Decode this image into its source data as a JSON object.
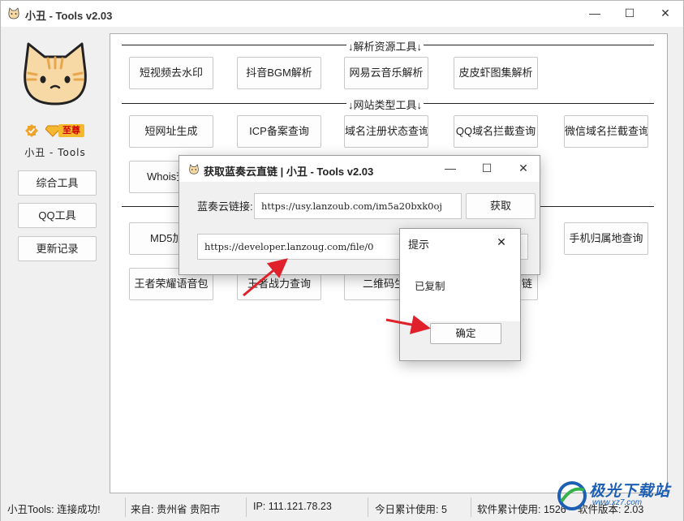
{
  "window": {
    "title": "小丑 - Tools v2.03",
    "controls": {
      "minimize": "—",
      "maximize": "☐",
      "close": "✕"
    }
  },
  "sidebar": {
    "user_name": "小丑 - Tools",
    "vip_badge": "至尊",
    "buttons": [
      "综合工具",
      "QQ工具",
      "更新记录"
    ]
  },
  "main": {
    "sections": [
      {
        "title": "↓解析资源工具↓"
      },
      {
        "title": "↓网站类型工具↓"
      }
    ],
    "row1": [
      "短视频去水印",
      "抖音BGM解析",
      "网易云音乐解析",
      "皮皮虾图集解析"
    ],
    "row2": [
      "短网址生成",
      "ICP备案查询",
      "域名注册状态查询",
      "QQ域名拦截查询",
      "微信域名拦截查询"
    ],
    "row3": [
      "Whois查"
    ],
    "row4": [
      "MD5加",
      "手机归属地查询"
    ],
    "row5": [
      "王者荣耀语音包",
      "王者战力查询",
      "二维码生",
      "链"
    ]
  },
  "dialog": {
    "title": "获取蓝奏云直链 | 小丑 - Tools v2.03",
    "label": "蓝奏云链接:",
    "input_value": "https://usy.lanzoub.com/im5a20bxk0oj",
    "fetch_button": "获取",
    "output_value": "https://developer.lanzoug.com/file/0",
    "controls": {
      "minimize": "—",
      "maximize": "☐",
      "close": "✕"
    }
  },
  "message_box": {
    "title": "提示",
    "message": "已复制",
    "ok_button": "确定",
    "close": "✕"
  },
  "statusbar": {
    "connection": "小丑Tools: 连接成功!",
    "location": "来自: 贵州省 贵阳市",
    "ip": "IP: 111.121.78.23",
    "today_usage": "今日累计使用: 5",
    "total_usage": "软件累计使用: 1526",
    "version": "软件版本: 2.03"
  },
  "watermark": {
    "text": "极光下载站",
    "sub": "www.xz7.com"
  },
  "colors": {
    "accent_red": "#e0202a",
    "watermark_blue": "#1d5fb4",
    "cat_face": "#f7d9a6",
    "cat_stripe": "#e8a64e"
  }
}
